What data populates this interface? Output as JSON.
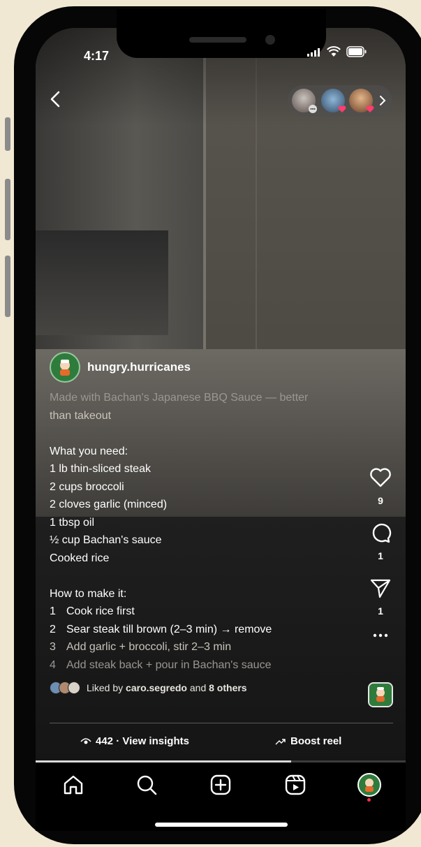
{
  "status_bar": {
    "time": "4:17"
  },
  "post": {
    "username": "hungry.hurricanes",
    "caption_lines": [
      {
        "text": "Made with Bachan's Japanese BBQ Sauce — better",
        "style": "fade"
      },
      {
        "text": "than takeout",
        "style": "dim"
      },
      {
        "text": "",
        "style": "blank"
      },
      {
        "text": "What you need:",
        "style": ""
      },
      {
        "text": "1 lb thin-sliced steak",
        "style": ""
      },
      {
        "text": "2 cups broccoli",
        "style": ""
      },
      {
        "text": "2 cloves garlic (minced)",
        "style": ""
      },
      {
        "text": "1 tbsp oil",
        "style": ""
      },
      {
        "text": "½ cup Bachan's sauce",
        "style": ""
      },
      {
        "text": "Cooked rice",
        "style": ""
      },
      {
        "text": "",
        "style": "blank"
      },
      {
        "text": "How to make it:",
        "style": ""
      }
    ],
    "steps": [
      {
        "num": "1",
        "text": "Cook rice first",
        "style": ""
      },
      {
        "num": "2",
        "text": "Sear steak till brown (2–3 min) → remove",
        "style": ""
      },
      {
        "num": "3",
        "text": "Add garlic + broccoli, stir 2–3 min",
        "style": "dim"
      },
      {
        "num": "4",
        "text": "Add steak back + pour in Bachan's sauce",
        "style": "fade"
      }
    ]
  },
  "actions": {
    "like_count": "9",
    "comment_count": "1",
    "share_count": "1"
  },
  "likes": {
    "prefix": "Liked by ",
    "user": "caro.segredo",
    "middle": " and ",
    "others": "8 others"
  },
  "footer": {
    "insights_label": "442 · View insights",
    "boost_label": "Boost reel"
  },
  "reel_progress": 0.69,
  "colors": {
    "accent_red": "#ff3040",
    "like_heart": "#ff3040",
    "tab_bg": "#000000"
  },
  "icons": [
    "back-chevron-icon",
    "heart-icon",
    "comment-icon",
    "share-icon",
    "more-icon",
    "eye-icon",
    "trend-up-icon",
    "home-icon",
    "search-icon",
    "create-icon",
    "reels-icon",
    "profile-avatar-icon"
  ]
}
